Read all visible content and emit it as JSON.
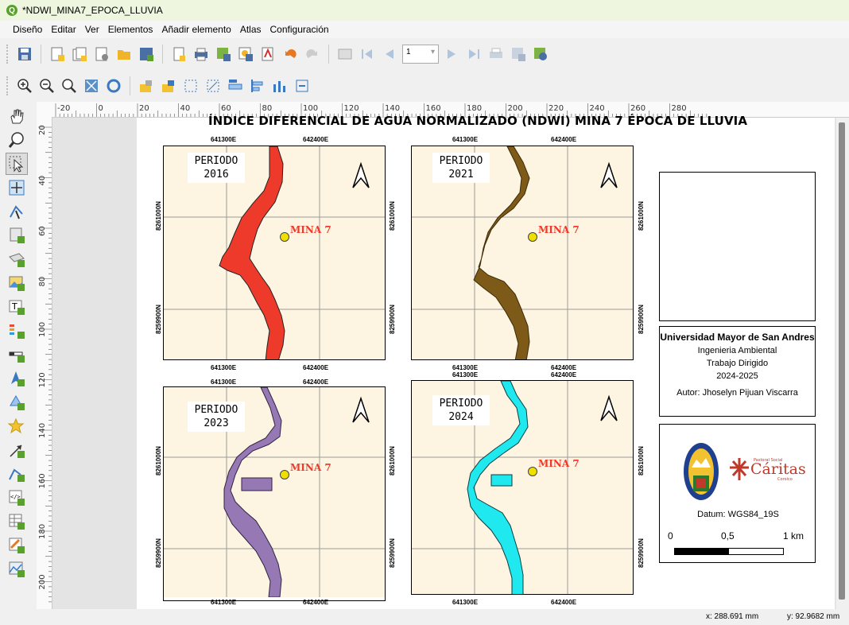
{
  "window": {
    "title": "*NDWI_MINA7_EPOCA_LLUVIA"
  },
  "menu": [
    "Diseño",
    "Editar",
    "Ver",
    "Elementos",
    "Añadir elemento",
    "Atlas",
    "Configuración"
  ],
  "atlas_page": "1",
  "ruler_h": [
    "-20",
    "0",
    "20",
    "40",
    "60",
    "80",
    "100",
    "120",
    "140",
    "160",
    "180",
    "200",
    "220",
    "240",
    "260",
    "280"
  ],
  "ruler_v": [
    "20",
    "40",
    "60",
    "80",
    "100",
    "120",
    "140",
    "160",
    "180",
    "200"
  ],
  "layout": {
    "title": "ÍNDICE DIFERENCIAL DE AGUA NORMALIZADO (NDWI) MINA 7 ÉPOCA DE LLUVIA",
    "maps": [
      {
        "period_label": "PERIODO",
        "year": "2016",
        "water_color": "#ee3a2a",
        "mine_label": "MINA 7"
      },
      {
        "period_label": "PERIODO",
        "year": "2021",
        "water_color": "#7d5a17",
        "mine_label": "MINA 7"
      },
      {
        "period_label": "PERIODO",
        "year": "2023",
        "water_color": "#9678b4",
        "mine_label": "MINA 7"
      },
      {
        "period_label": "PERIODO",
        "year": "2024",
        "water_color": "#1fe8ee",
        "mine_label": "MINA 7"
      }
    ],
    "grid": {
      "x_left": "641300E",
      "x_right": "642400E",
      "y_top": "8261000N",
      "y_bottom": "8259900N"
    },
    "info": {
      "university": "Universidad Mayor de San Andres",
      "program": "Ingenieria Ambiental",
      "work": "Trabajo Dirigido",
      "years": "2024-2025",
      "author": "Autor: Jhoselyn Pijuan Viscarra"
    },
    "datum": "Datum: WGS84_19S",
    "scale": {
      "l0": "0",
      "l1": "0,5",
      "l2": "1 km"
    },
    "caritas": {
      "top": "Pastoral Social",
      "name": "Cáritas",
      "sub": "Coroico"
    }
  },
  "status": {
    "x": "x: 288.691 mm",
    "y": "y: 92.9682 mm"
  },
  "colors": {
    "map_bg": "#fdf5e1",
    "mine_marker": "#f0e000",
    "mine_label": "#ee3a2a",
    "title_bar": "#eef6df"
  }
}
